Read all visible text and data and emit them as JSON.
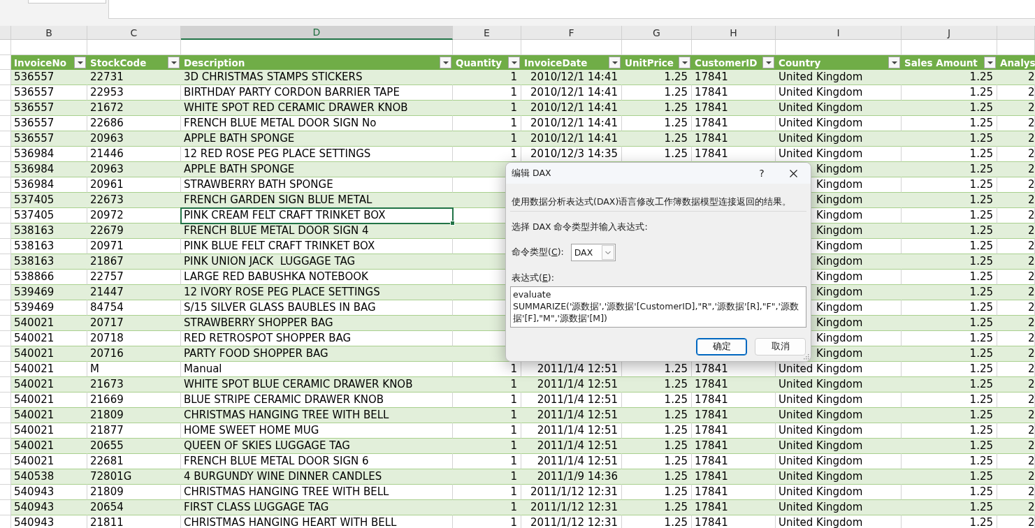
{
  "column_headers": [
    {
      "letter": "B",
      "selected": false
    },
    {
      "letter": "C",
      "selected": false
    },
    {
      "letter": "D",
      "selected": true
    },
    {
      "letter": "E",
      "selected": false
    },
    {
      "letter": "F",
      "selected": false
    },
    {
      "letter": "G",
      "selected": false
    },
    {
      "letter": "H",
      "selected": false
    },
    {
      "letter": "I",
      "selected": false
    },
    {
      "letter": "J",
      "selected": false
    }
  ],
  "table": {
    "columns": [
      {
        "name": "InvoiceNo",
        "kind": "text",
        "filter": true
      },
      {
        "name": "StockCode",
        "kind": "text",
        "filter": true
      },
      {
        "name": "Description",
        "kind": "text",
        "filter": true
      },
      {
        "name": "Quantity",
        "kind": "number",
        "filter": true
      },
      {
        "name": "InvoiceDate",
        "kind": "number",
        "filter": true
      },
      {
        "name": "UnitPrice",
        "kind": "number",
        "filter": true
      },
      {
        "name": "CustomerID",
        "kind": "text",
        "filter": true
      },
      {
        "name": "Country",
        "kind": "text",
        "filter": true
      },
      {
        "name": "Sales Amount",
        "kind": "number",
        "filter": true
      },
      {
        "name": "Analys",
        "kind": "clipped",
        "filter": false
      }
    ],
    "rows": [
      {
        "selected": false,
        "covered": false,
        "cells": [
          "536557",
          "22731",
          "3D CHRISTMAS STAMPS STICKERS",
          "1",
          "2010/12/1 14:41",
          "1.25",
          "17841",
          "United Kingdom",
          "1.25",
          "2"
        ]
      },
      {
        "selected": false,
        "covered": false,
        "cells": [
          "536557",
          "22953",
          "BIRTHDAY PARTY CORDON BARRIER TAPE",
          "1",
          "2010/12/1 14:41",
          "1.25",
          "17841",
          "United Kingdom",
          "1.25",
          "2"
        ]
      },
      {
        "selected": false,
        "covered": false,
        "cells": [
          "536557",
          "21672",
          "WHITE SPOT RED CERAMIC DRAWER KNOB",
          "1",
          "2010/12/1 14:41",
          "1.25",
          "17841",
          "United Kingdom",
          "1.25",
          "2"
        ]
      },
      {
        "selected": false,
        "covered": false,
        "cells": [
          "536557",
          "22686",
          "FRENCH BLUE METAL DOOR SIGN No",
          "1",
          "2010/12/1 14:41",
          "1.25",
          "17841",
          "United Kingdom",
          "1.25",
          "2"
        ]
      },
      {
        "selected": false,
        "covered": false,
        "cells": [
          "536557",
          "20963",
          "APPLE BATH SPONGE",
          "1",
          "2010/12/1 14:41",
          "1.25",
          "17841",
          "United Kingdom",
          "1.25",
          "2"
        ]
      },
      {
        "selected": false,
        "covered": false,
        "cells": [
          "536984",
          "21446",
          "12 RED ROSE PEG PLACE SETTINGS",
          "1",
          "2010/12/3 14:35",
          "1.25",
          "17841",
          "United Kingdom",
          "1.25",
          "2"
        ]
      },
      {
        "selected": false,
        "covered": true,
        "cells": [
          "536984",
          "20963",
          "APPLE BATH SPONGE",
          "Kingdom",
          "1.25",
          "2"
        ]
      },
      {
        "selected": false,
        "covered": true,
        "cells": [
          "536984",
          "20961",
          "STRAWBERRY BATH SPONGE",
          "Kingdom",
          "1.25",
          "2"
        ]
      },
      {
        "selected": false,
        "covered": true,
        "cells": [
          "537405",
          "22673",
          "FRENCH GARDEN SIGN BLUE METAL",
          "Kingdom",
          "1.25",
          "2"
        ]
      },
      {
        "selected": true,
        "covered": true,
        "cells": [
          "537405",
          "20972",
          "PINK CREAM FELT CRAFT TRINKET BOX",
          "Kingdom",
          "1.25",
          "2"
        ]
      },
      {
        "selected": false,
        "covered": true,
        "cells": [
          "538163",
          "22679",
          "FRENCH BLUE METAL DOOR SIGN 4",
          "Kingdom",
          "1.25",
          "2"
        ]
      },
      {
        "selected": false,
        "covered": true,
        "cells": [
          "538163",
          "20971",
          "PINK BLUE FELT CRAFT TRINKET BOX",
          "Kingdom",
          "1.25",
          "2"
        ]
      },
      {
        "selected": false,
        "covered": true,
        "cells": [
          "538163",
          "21867",
          "PINK UNION JACK  LUGGAGE TAG",
          "Kingdom",
          "1.25",
          "2"
        ]
      },
      {
        "selected": false,
        "covered": true,
        "cells": [
          "538866",
          "22757",
          "LARGE RED BABUSHKA NOTEBOOK",
          "Kingdom",
          "1.25",
          "2"
        ]
      },
      {
        "selected": false,
        "covered": true,
        "cells": [
          "539469",
          "21447",
          "12 IVORY ROSE PEG PLACE SETTINGS",
          "Kingdom",
          "1.25",
          "2"
        ]
      },
      {
        "selected": false,
        "covered": true,
        "cells": [
          "539469",
          "84754",
          "S/15 SILVER GLASS BAUBLES IN BAG",
          "Kingdom",
          "1.25",
          "2"
        ]
      },
      {
        "selected": false,
        "covered": true,
        "cells": [
          "540021",
          "20717",
          "STRAWBERRY SHOPPER BAG",
          "Kingdom",
          "1.25",
          "2"
        ]
      },
      {
        "selected": false,
        "covered": true,
        "cells": [
          "540021",
          "20718",
          "RED RETROSPOT SHOPPER BAG",
          "Kingdom",
          "1.25",
          "2"
        ]
      },
      {
        "selected": false,
        "covered": true,
        "cells": [
          "540021",
          "20716",
          "PARTY FOOD SHOPPER BAG",
          "Kingdom",
          "1.25",
          "2"
        ]
      },
      {
        "selected": false,
        "covered": false,
        "cells": [
          "540021",
          "M",
          "Manual",
          "1",
          "2011/1/4 12:51",
          "1.25",
          "17841",
          "United Kingdom",
          "1.25",
          "2"
        ]
      },
      {
        "selected": false,
        "covered": false,
        "cells": [
          "540021",
          "21673",
          "WHITE SPOT BLUE CERAMIC DRAWER KNOB",
          "1",
          "2011/1/4 12:51",
          "1.25",
          "17841",
          "United Kingdom",
          "1.25",
          "2"
        ]
      },
      {
        "selected": false,
        "covered": false,
        "cells": [
          "540021",
          "21669",
          "BLUE STRIPE CERAMIC DRAWER KNOB",
          "1",
          "2011/1/4 12:51",
          "1.25",
          "17841",
          "United Kingdom",
          "1.25",
          "2"
        ]
      },
      {
        "selected": false,
        "covered": false,
        "cells": [
          "540021",
          "21809",
          "CHRISTMAS HANGING TREE WITH BELL",
          "1",
          "2011/1/4 12:51",
          "1.25",
          "17841",
          "United Kingdom",
          "1.25",
          "2"
        ]
      },
      {
        "selected": false,
        "covered": false,
        "cells": [
          "540021",
          "21877",
          "HOME SWEET HOME MUG",
          "1",
          "2011/1/4 12:51",
          "1.25",
          "17841",
          "United Kingdom",
          "1.25",
          "2"
        ]
      },
      {
        "selected": false,
        "covered": false,
        "cells": [
          "540021",
          "20655",
          "QUEEN OF SKIES LUGGAGE TAG",
          "1",
          "2011/1/4 12:51",
          "1.25",
          "17841",
          "United Kingdom",
          "1.25",
          "2"
        ]
      },
      {
        "selected": false,
        "covered": false,
        "cells": [
          "540021",
          "22681",
          "FRENCH BLUE METAL DOOR SIGN 6",
          "1",
          "2011/1/4 12:51",
          "1.25",
          "17841",
          "United Kingdom",
          "1.25",
          "2"
        ]
      },
      {
        "selected": false,
        "covered": false,
        "cells": [
          "540538",
          "72801G",
          "4 BURGUNDY WINE DINNER CANDLES",
          "1",
          "2011/1/9 14:36",
          "1.25",
          "17841",
          "United Kingdom",
          "1.25",
          "2"
        ]
      },
      {
        "selected": false,
        "covered": false,
        "cells": [
          "540943",
          "21809",
          "CHRISTMAS HANGING TREE WITH BELL",
          "1",
          "2011/1/12 12:31",
          "1.25",
          "17841",
          "United Kingdom",
          "1.25",
          "2"
        ]
      },
      {
        "selected": false,
        "covered": false,
        "cells": [
          "540943",
          "20654",
          "FIRST CLASS LUGGAGE TAG",
          "1",
          "2011/1/12 12:31",
          "1.25",
          "17841",
          "United Kingdom",
          "1.25",
          "2"
        ]
      },
      {
        "selected": false,
        "covered": false,
        "cells": [
          "540943",
          "21811",
          "CHRISTMAS HANGING HEART WITH BELL",
          "1",
          "2011/1/12 12:31",
          "1.25",
          "17841",
          "United Kingdom",
          "1.25",
          "2"
        ]
      }
    ]
  },
  "dialog": {
    "title": "编辑 DAX",
    "help_button": "?",
    "description": "使用数据分析表达式(DAX)语言修改工作簿数据模型连接返回的结果。",
    "instruction": "选择 DAX 命令类型并输入表达式:",
    "command_type": {
      "label": [
        "命令类型(",
        "C",
        "):"
      ],
      "value": "DAX"
    },
    "expression": {
      "label": [
        "表达式(",
        "E",
        "):"
      ],
      "value": "evaluate\nSUMMARIZE('源数据','源数据'[CustomerID],\"R\",'源数据'[R],\"F\",'源数据'[F],\"M\",'源数据'[M])"
    },
    "buttons": [
      {
        "label": "确定",
        "default": true
      },
      {
        "label": "取消",
        "default": false
      }
    ]
  }
}
